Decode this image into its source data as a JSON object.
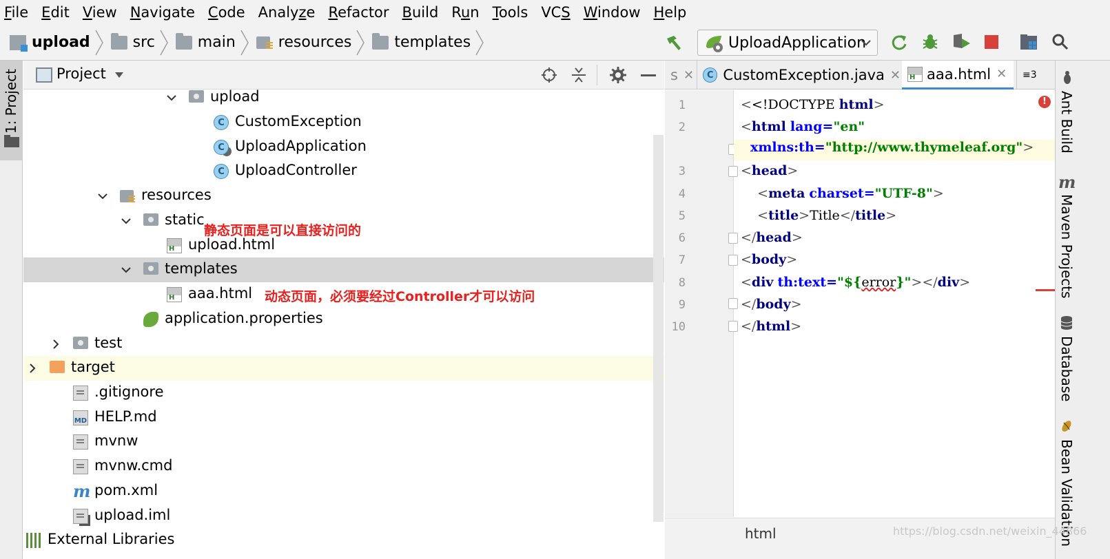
{
  "menu": [
    "File",
    "Edit",
    "View",
    "Navigate",
    "Code",
    "Analyze",
    "Refactor",
    "Build",
    "Run",
    "Tools",
    "VCS",
    "Window",
    "Help"
  ],
  "menu_mnemonic": [
    "F",
    "E",
    "V",
    "N",
    "C",
    "z",
    "R",
    "B",
    "u",
    "T",
    "S",
    "W",
    "H"
  ],
  "breadcrumb": [
    "upload",
    "src",
    "main",
    "resources",
    "templates"
  ],
  "run_config": "UploadApplication",
  "left_strip": {
    "project_tab": "1: Project"
  },
  "project": {
    "title": "Project",
    "tree": [
      {
        "label": "upload",
        "icon": "folder-icon"
      },
      {
        "label": "CustomException",
        "icon": "class-icon"
      },
      {
        "label": "UploadApplication",
        "icon": "spring-boot-class-icon"
      },
      {
        "label": "UploadController",
        "icon": "class-icon"
      },
      {
        "label": "resources",
        "icon": "resources-folder-icon"
      },
      {
        "label": "static",
        "icon": "folder-icon"
      },
      {
        "label": "upload.html",
        "icon": "html-file-icon"
      },
      {
        "label": "templates",
        "icon": "folder-icon"
      },
      {
        "label": "aaa.html",
        "icon": "html-file-icon"
      },
      {
        "label": "application.properties",
        "icon": "spring-properties-icon"
      },
      {
        "label": "test",
        "icon": "folder-icon"
      },
      {
        "label": "target",
        "icon": "excluded-folder-icon"
      },
      {
        "label": ".gitignore",
        "icon": "text-file-icon"
      },
      {
        "label": "HELP.md",
        "icon": "markdown-file-icon"
      },
      {
        "label": "mvnw",
        "icon": "text-file-icon"
      },
      {
        "label": "mvnw.cmd",
        "icon": "text-file-icon"
      },
      {
        "label": "pom.xml",
        "icon": "maven-icon"
      },
      {
        "label": "upload.iml",
        "icon": "module-file-icon"
      },
      {
        "label": "External Libraries",
        "icon": "libraries-icon"
      }
    ],
    "annotations": {
      "static": "静态页面是可以直接访问的",
      "templates": "动态页面，必须要经过Controller才可以访问"
    }
  },
  "editor": {
    "tabs": [
      {
        "label": "s"
      },
      {
        "label": "CustomException.java"
      },
      {
        "label": "aaa.html"
      },
      {
        "label": "≡3"
      }
    ],
    "line_numbers": [
      "1",
      "2",
      "",
      "3",
      "4",
      "5",
      "6",
      "7",
      "8",
      "9",
      "10"
    ],
    "code": {
      "l1_a": "<!DOCTYPE ",
      "l1_b": "html",
      "l1_c": ">",
      "l2_tag": "html",
      "l2_attr": "lang",
      "l2_val": "\"en\"",
      "l2b_attr": "xmlns:th",
      "l2b_val": "\"http://www.thymeleaf.org\"",
      "l3": "head",
      "l4_tag": "meta",
      "l4_attr": "charset",
      "l4_val": "\"UTF-8\"",
      "l5_tag": "title",
      "l5_text": "Title",
      "l6": "head",
      "l7": "body",
      "l8_tag": "div",
      "l8_attr": "th:text",
      "l8_pre": "\"${",
      "l8_err": "error",
      "l8_post": "}\"",
      "l9": "body",
      "l10": "html"
    },
    "breadcrumb": "html"
  },
  "right_strip": [
    "Ant Build",
    "Maven Projects",
    "Database",
    "Bean Validation"
  ],
  "watermark": "https://blog.csdn.net/weixin_44866"
}
